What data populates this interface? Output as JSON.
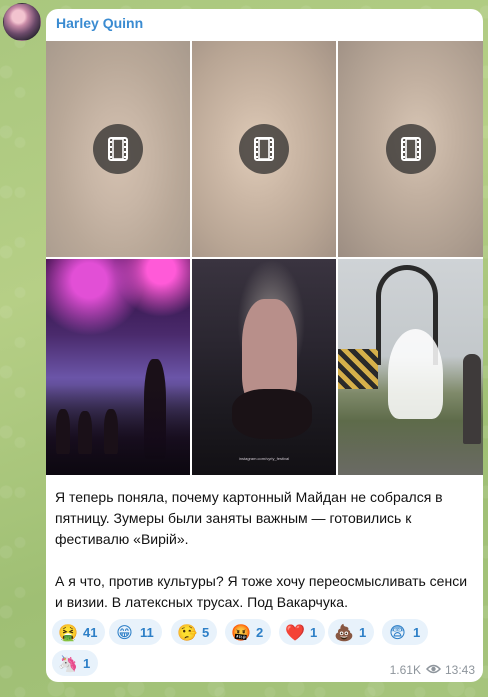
{
  "message": {
    "sender": "Harley Quinn",
    "text": "Я теперь поняла, почему картонный Майдан не собрался в пятницу. Зумеры были заняты важным — готовились к фестивалю «Вирій».\n\nА я что, против культуры? Я тоже хочу переосмысливать сенси и визии. В латексных трусах. Под Вакарчука.",
    "views": "1.61K",
    "time": "13:43"
  },
  "media": {
    "videos": [
      {
        "icon": "video-film-icon"
      },
      {
        "icon": "video-film-icon"
      },
      {
        "icon": "video-film-icon"
      }
    ],
    "photos": [
      {
        "name": "concert-photo"
      },
      {
        "name": "performer-photo",
        "caption": "instagram.com/vyriy_festival"
      },
      {
        "name": "festival-photo"
      }
    ]
  },
  "reactions": [
    {
      "emoji": "🤮",
      "count": "41"
    },
    {
      "emoji": "😁",
      "count": "11"
    },
    {
      "emoji": "🤥",
      "count": "5"
    },
    {
      "emoji": "🤬",
      "count": "2"
    },
    {
      "emoji": "❤️",
      "count": "1"
    },
    {
      "emoji": "💩",
      "count": "1"
    },
    {
      "emoji": "😨",
      "count": "1"
    },
    {
      "emoji": "🦄",
      "count": "1"
    }
  ],
  "colors": {
    "sender": "#3a8bd1",
    "reaction_bg": "#e8f2fb",
    "reaction_text": "#2d7fc7",
    "meta": "#8e959c"
  }
}
